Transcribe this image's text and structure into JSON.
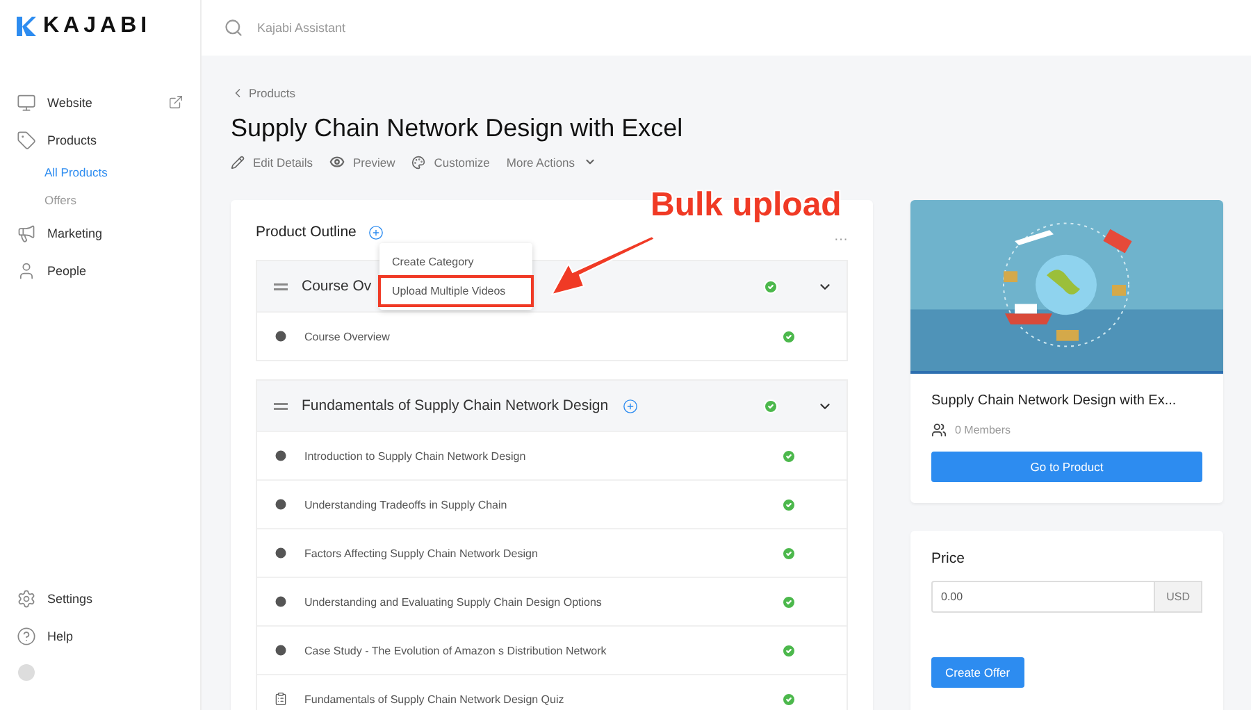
{
  "logo": {
    "text": "KAJABI"
  },
  "search": {
    "placeholder": "Kajabi Assistant"
  },
  "sidebar": {
    "items": [
      {
        "label": "Website",
        "external": true
      },
      {
        "label": "Products",
        "external": false,
        "children": [
          {
            "label": "All Products",
            "selected": true
          },
          {
            "label": "Offers",
            "selected": false
          }
        ]
      },
      {
        "label": "Marketing",
        "external": false
      },
      {
        "label": "People",
        "external": false
      }
    ],
    "bottom_items": [
      {
        "label": "Settings"
      },
      {
        "label": "Help"
      }
    ]
  },
  "breadcrumb": "Products",
  "title": "Supply Chain Network Design with Excel",
  "actions": [
    {
      "label": "Edit Details",
      "kind": "link"
    },
    {
      "label": "Preview",
      "kind": "link"
    },
    {
      "label": "Customize",
      "kind": "link"
    },
    {
      "label": "More Actions",
      "kind": "menu"
    }
  ],
  "outline": {
    "title": "Product Outline",
    "more": "···",
    "menu": [
      "Create Category",
      "Upload Multiple Videos"
    ],
    "categories": [
      {
        "title": "Course Ov",
        "add_button": false,
        "lessons": [
          {
            "title": "Course Overview",
            "kind": "video"
          }
        ]
      },
      {
        "title": "Fundamentals of Supply Chain Network Design",
        "add_button": true,
        "lessons": [
          {
            "title": "Introduction to Supply Chain Network Design",
            "kind": "video"
          },
          {
            "title": "Understanding Tradeoffs in Supply Chain",
            "kind": "video"
          },
          {
            "title": "Factors Affecting Supply Chain Network Design",
            "kind": "video"
          },
          {
            "title": "Understanding and Evaluating Supply Chain Design Options",
            "kind": "video"
          },
          {
            "title": "Case Study - The Evolution of Amazon s Distribution Network",
            "kind": "video"
          },
          {
            "title": "Fundamentals of Supply Chain Network Design Quiz",
            "kind": "quiz"
          }
        ]
      }
    ]
  },
  "product_card": {
    "title": "Supply Chain Network Design with Ex...",
    "members": "0 Members",
    "button": "Go to Product"
  },
  "price_card": {
    "title": "Price",
    "value": "0.00",
    "currency": "USD",
    "button": "Create Offer"
  },
  "annotation": {
    "text": "Bulk upload"
  }
}
